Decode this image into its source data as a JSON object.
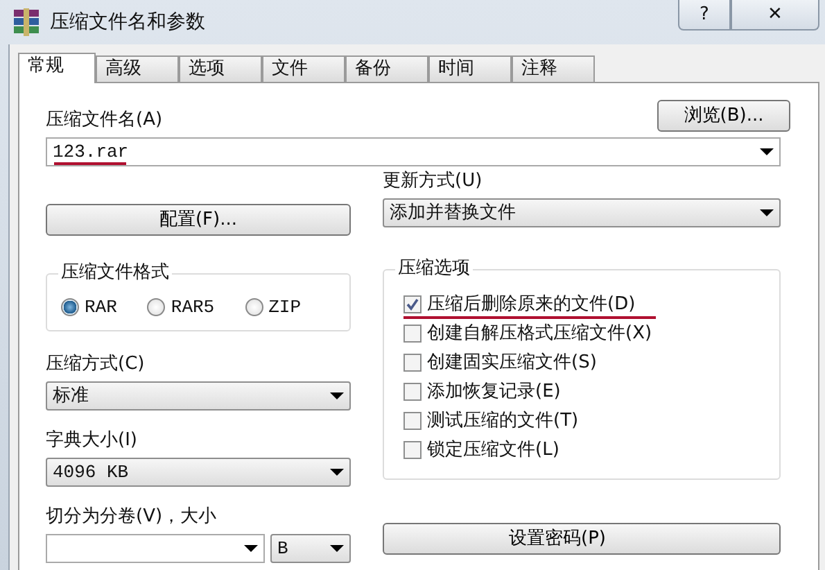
{
  "window": {
    "title": "压缩文件名和参数",
    "help": "?",
    "close": "✕"
  },
  "tabs": [
    {
      "label": "常规",
      "selected": true
    },
    {
      "label": "高级",
      "selected": false
    },
    {
      "label": "选项",
      "selected": false
    },
    {
      "label": "文件",
      "selected": false
    },
    {
      "label": "备份",
      "selected": false
    },
    {
      "label": "时间",
      "selected": false
    },
    {
      "label": "注释",
      "selected": false
    }
  ],
  "archive_name": {
    "label": "压缩文件名(A)",
    "value": "123.rar",
    "underlined": true,
    "browse_button": "浏览(B)..."
  },
  "profiles_button": "配置(F)...",
  "update_mode": {
    "label": "更新方式(U)",
    "value": "添加并替换文件"
  },
  "archive_format": {
    "title": "压缩文件格式",
    "options": [
      {
        "label": "RAR",
        "selected": true
      },
      {
        "label": "RAR5",
        "selected": false
      },
      {
        "label": "ZIP",
        "selected": false
      }
    ]
  },
  "compression_method": {
    "label": "压缩方式(C)",
    "value": "标准"
  },
  "dictionary_size": {
    "label": "字典大小(I)",
    "value": "4096 KB"
  },
  "split_volumes": {
    "label": "切分为分卷(V)，大小",
    "unit": "B"
  },
  "archive_options": {
    "title": "压缩选项",
    "items": [
      {
        "label": "压缩后删除原来的文件(D)",
        "checked": true,
        "underlined": true
      },
      {
        "label": "创建自解压格式压缩文件(X)",
        "checked": false,
        "underlined": false
      },
      {
        "label": "创建固实压缩文件(S)",
        "checked": false,
        "underlined": false
      },
      {
        "label": "添加恢复记录(E)",
        "checked": false,
        "underlined": false
      },
      {
        "label": "测试压缩的文件(T)",
        "checked": false,
        "underlined": false
      },
      {
        "label": "锁定压缩文件(L)",
        "checked": false,
        "underlined": false
      }
    ]
  },
  "password_button": "设置密码(P)"
}
